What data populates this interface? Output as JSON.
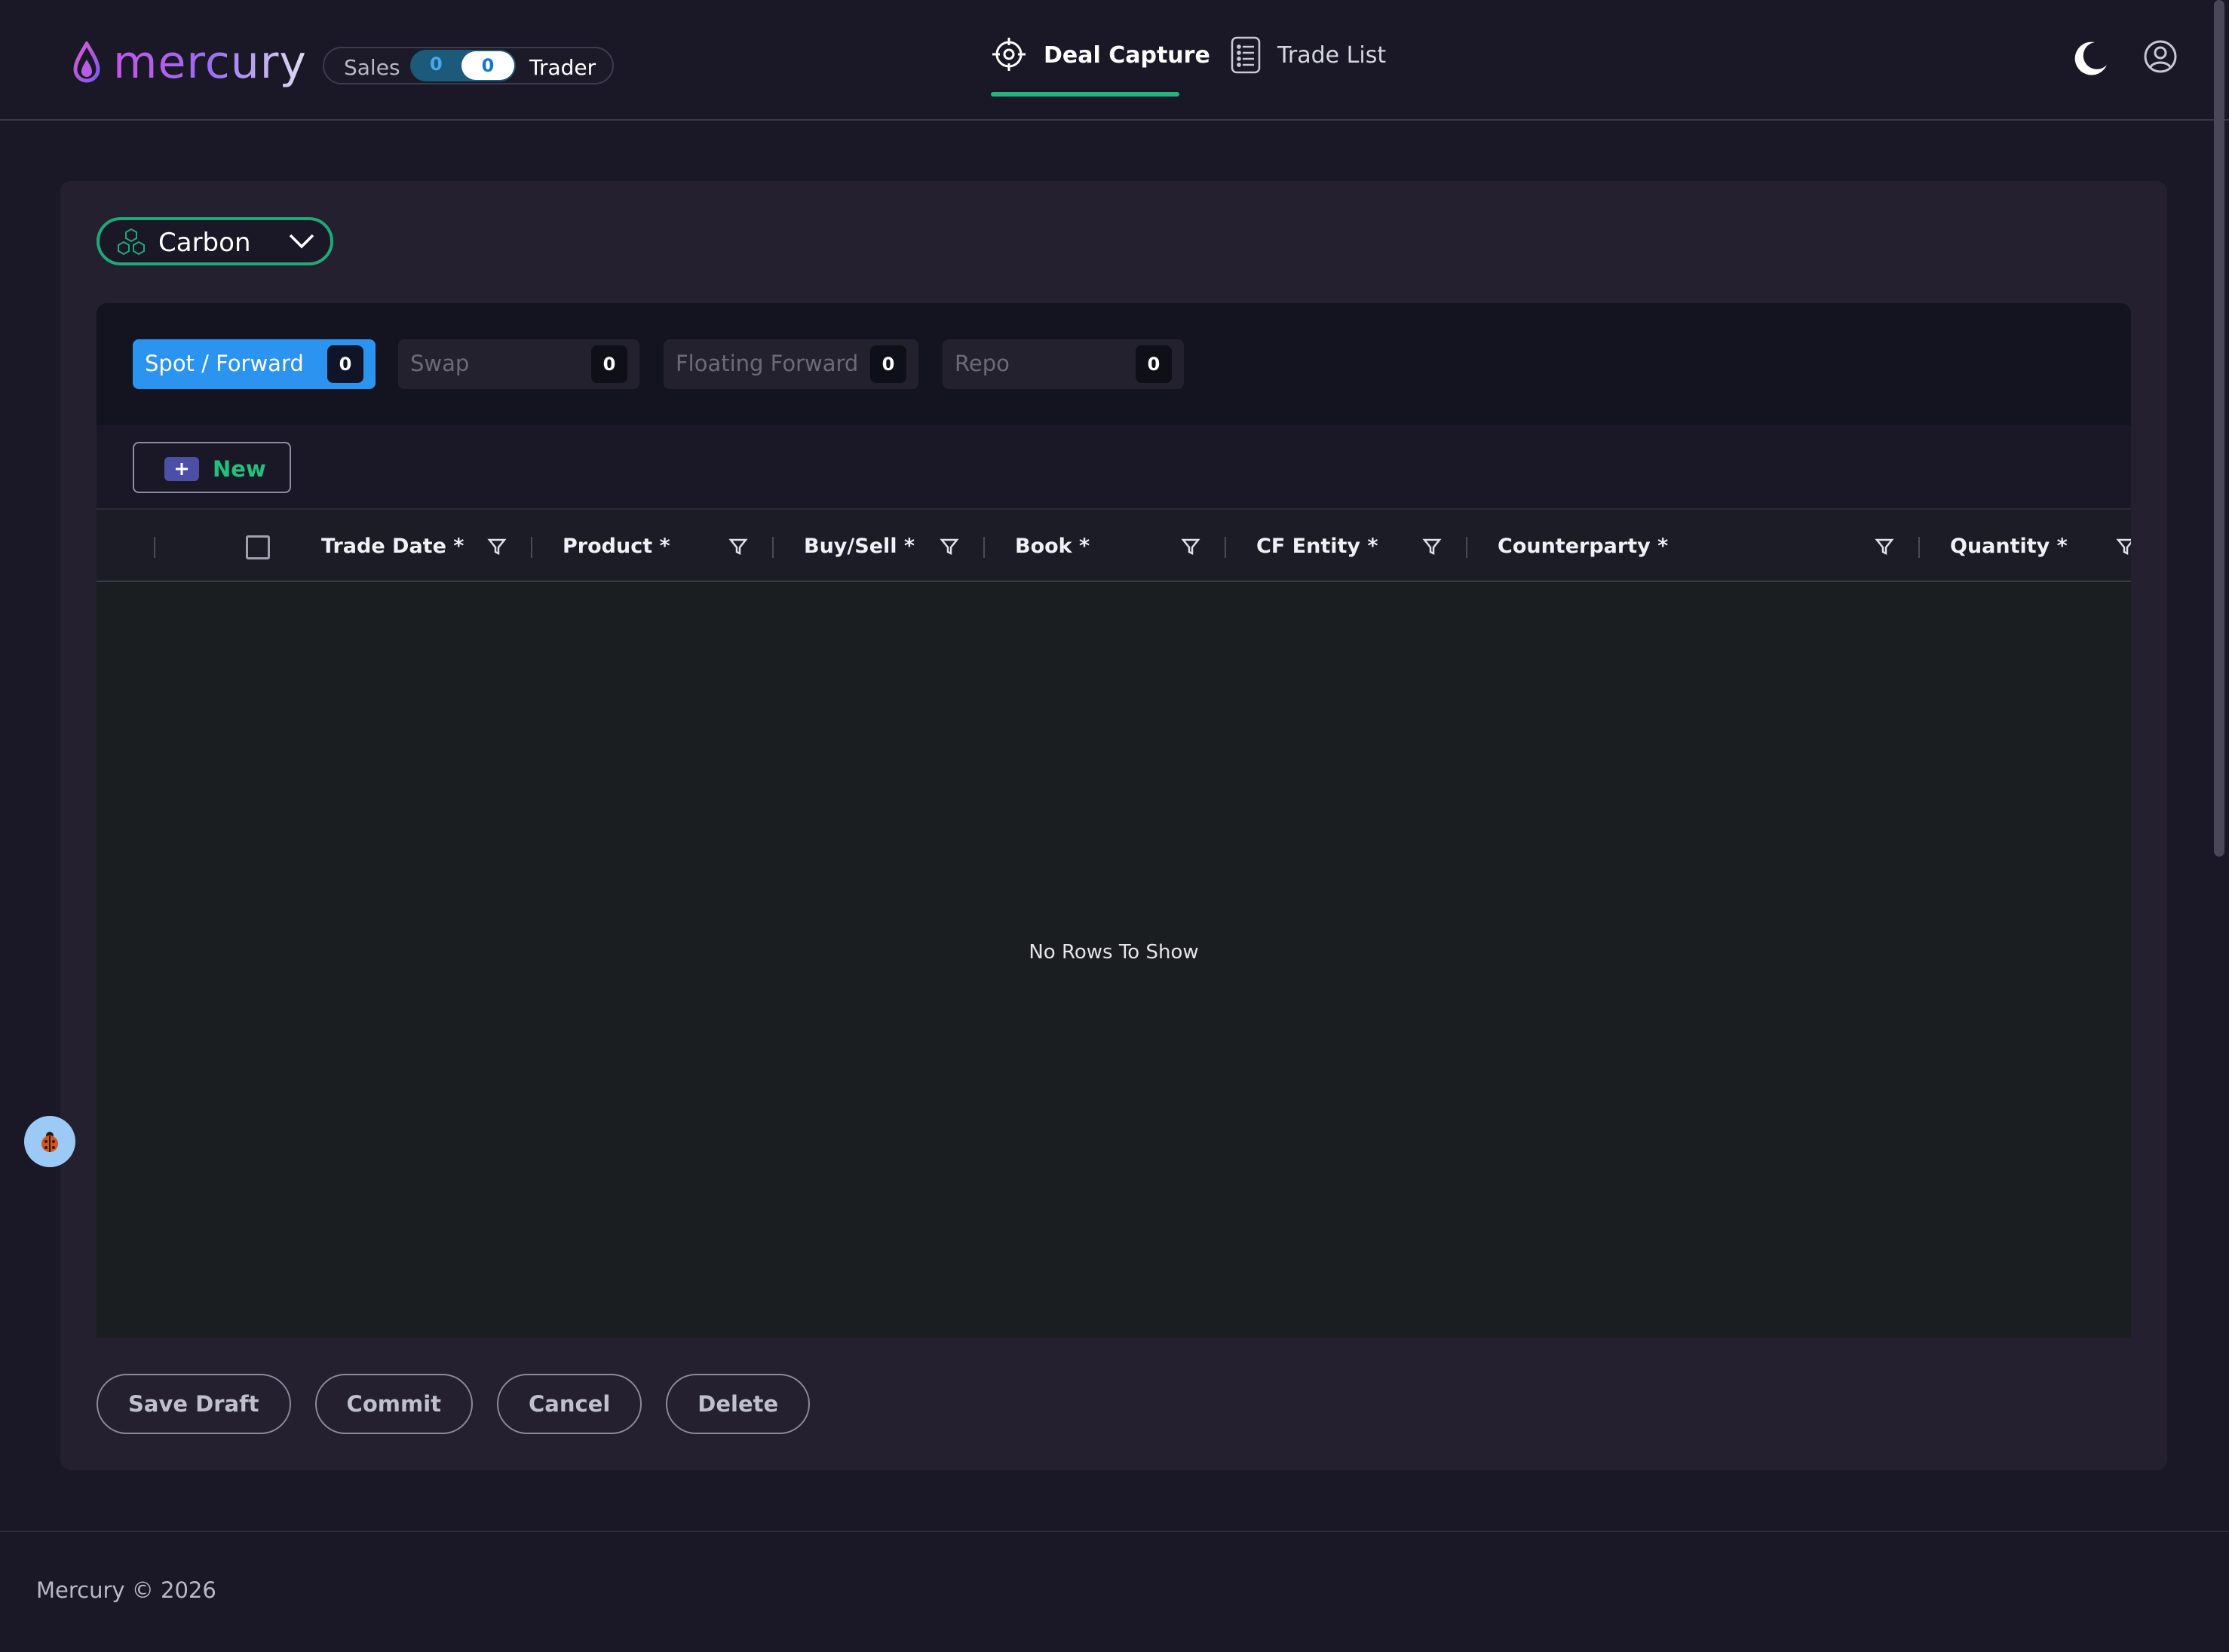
{
  "header": {
    "logo_text": "mercury",
    "role_toggle": {
      "left_label": "Sales",
      "left_count": "0",
      "right_count": "0",
      "right_label": "Trader"
    },
    "nav": [
      {
        "label": "Deal Capture",
        "icon": "crosshair-icon",
        "active": true
      },
      {
        "label": "Trade List",
        "icon": "list-icon",
        "active": false
      }
    ],
    "theme_icon": "moon-icon",
    "profile_icon": "user-circle-icon"
  },
  "product_selector": {
    "value": "Carbon",
    "icon": "hexagon-cluster-icon"
  },
  "trade_types": [
    {
      "label": "Spot / Forward",
      "count": "0",
      "active": true
    },
    {
      "label": "Swap",
      "count": "0",
      "active": false
    },
    {
      "label": "Floating Forward",
      "count": "0",
      "active": false
    },
    {
      "label": "Repo",
      "count": "0",
      "active": false
    }
  ],
  "toolbar": {
    "new_label": "New"
  },
  "grid": {
    "columns": [
      "Trade Date *",
      "Product *",
      "Buy/Sell *",
      "Book *",
      "CF Entity *",
      "Counterparty *",
      "Quantity *"
    ],
    "empty_message": "No Rows To Show"
  },
  "actions": {
    "save_draft": "Save Draft",
    "commit": "Commit",
    "cancel": "Cancel",
    "delete": "Delete"
  },
  "footer": {
    "text": "Mercury © 2026"
  },
  "colors": {
    "accent_green": "#21b67a",
    "accent_blue": "#2b93f0",
    "background": "#1a1826",
    "card": "#24202f"
  }
}
